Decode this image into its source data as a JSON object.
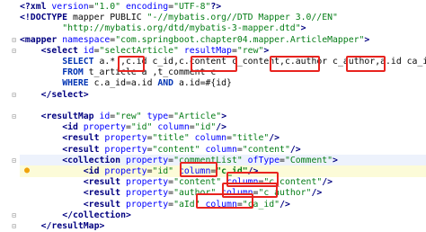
{
  "lines": [
    {
      "id": "l1",
      "segs": [
        [
          "tag",
          "<?"
        ],
        [
          "tag",
          "xml "
        ],
        [
          "attr",
          "version"
        ],
        [
          "plain",
          "="
        ],
        [
          "str",
          "\"1.0\""
        ],
        [
          "plain",
          " "
        ],
        [
          "attr",
          "encoding"
        ],
        [
          "plain",
          "="
        ],
        [
          "str",
          "\"UTF-8\""
        ],
        [
          "tag",
          "?>"
        ]
      ]
    },
    {
      "id": "l2",
      "segs": [
        [
          "tag",
          "<!DOCTYPE "
        ],
        [
          "plain",
          "mapper PUBLIC "
        ],
        [
          "str",
          "\"-//mybatis.org//DTD Mapper 3.0//EN\""
        ]
      ]
    },
    {
      "id": "l3",
      "segs": [
        [
          "plain",
          "        "
        ],
        [
          "str",
          "\"http://mybatis.org/dtd/mybatis-3-mapper.dtd\""
        ],
        [
          "tag",
          ">"
        ]
      ]
    },
    {
      "id": "l4",
      "segs": [
        [
          "tag",
          "<mapper "
        ],
        [
          "attr",
          "namespace"
        ],
        [
          "plain",
          "="
        ],
        [
          "str",
          "\"com.springboot.chapter04.mapper.ArticleMapper\""
        ],
        [
          "tag",
          ">"
        ]
      ]
    },
    {
      "id": "l5",
      "segs": [
        [
          "plain",
          "    "
        ],
        [
          "tag",
          "<select "
        ],
        [
          "attr",
          "id"
        ],
        [
          "plain",
          "="
        ],
        [
          "str",
          "\"selectArticle\""
        ],
        [
          "plain",
          " "
        ],
        [
          "attr",
          "resultMap"
        ],
        [
          "plain",
          "="
        ],
        [
          "str",
          "\"rew\""
        ],
        [
          "tag",
          ">"
        ]
      ]
    },
    {
      "id": "l6",
      "segs": [
        [
          "plain",
          "        "
        ],
        [
          "sqlkw",
          "SELECT"
        ],
        [
          "plain",
          " a.* ,c.id "
        ],
        [
          "plain",
          "c_id"
        ],
        [
          "plain",
          ",c.content "
        ],
        [
          "plain",
          "c_content"
        ],
        [
          "plain",
          ","
        ],
        [
          "plain",
          "c.author "
        ],
        [
          "plain",
          "c_author"
        ],
        [
          "plain",
          ",a.id "
        ],
        [
          "plain",
          "ca_id"
        ]
      ]
    },
    {
      "id": "l7",
      "segs": [
        [
          "plain",
          "        "
        ],
        [
          "sqlkw",
          "FROM"
        ],
        [
          "plain",
          " t_article a ,t_comment c"
        ]
      ]
    },
    {
      "id": "l8",
      "segs": [
        [
          "plain",
          "        "
        ],
        [
          "sqlkw",
          "WHERE"
        ],
        [
          "plain",
          " c.a_id=a.id "
        ],
        [
          "sqlkw",
          "AND"
        ],
        [
          "plain",
          " a.id="
        ],
        [
          "plain",
          "#{id}"
        ]
      ]
    },
    {
      "id": "l9",
      "segs": [
        [
          "plain",
          "    "
        ],
        [
          "tag",
          "</select>"
        ]
      ]
    },
    {
      "id": "l10",
      "segs": [
        [
          "plain",
          ""
        ]
      ]
    },
    {
      "id": "l11",
      "segs": [
        [
          "plain",
          "    "
        ],
        [
          "tag",
          "<resultMap "
        ],
        [
          "attr",
          "id"
        ],
        [
          "plain",
          "="
        ],
        [
          "str",
          "\"rew\""
        ],
        [
          "plain",
          " "
        ],
        [
          "attr",
          "type"
        ],
        [
          "plain",
          "="
        ],
        [
          "str",
          "\"Article\""
        ],
        [
          "tag",
          ">"
        ]
      ]
    },
    {
      "id": "l12",
      "segs": [
        [
          "plain",
          "        "
        ],
        [
          "tag",
          "<id "
        ],
        [
          "attr",
          "property"
        ],
        [
          "plain",
          "="
        ],
        [
          "str",
          "\"id\""
        ],
        [
          "plain",
          " "
        ],
        [
          "attr",
          "column"
        ],
        [
          "plain",
          "="
        ],
        [
          "str",
          "\"id\""
        ],
        [
          "tag",
          "/>"
        ]
      ]
    },
    {
      "id": "l13",
      "segs": [
        [
          "plain",
          "        "
        ],
        [
          "tag",
          "<result "
        ],
        [
          "attr",
          "property"
        ],
        [
          "plain",
          "="
        ],
        [
          "str",
          "\"title\""
        ],
        [
          "plain",
          " "
        ],
        [
          "attr",
          "column"
        ],
        [
          "plain",
          "="
        ],
        [
          "str",
          "\"title\""
        ],
        [
          "tag",
          "/>"
        ]
      ]
    },
    {
      "id": "l14",
      "segs": [
        [
          "plain",
          "        "
        ],
        [
          "tag",
          "<result "
        ],
        [
          "attr",
          "property"
        ],
        [
          "plain",
          "="
        ],
        [
          "str",
          "\"content\""
        ],
        [
          "plain",
          " "
        ],
        [
          "attr",
          "column"
        ],
        [
          "plain",
          "="
        ],
        [
          "str",
          "\"content\""
        ],
        [
          "tag",
          "/>"
        ]
      ]
    },
    {
      "id": "l15",
      "segs": [
        [
          "plain",
          "        "
        ],
        [
          "tag",
          "<collection "
        ],
        [
          "attr",
          "property"
        ],
        [
          "plain",
          "="
        ],
        [
          "str",
          "\"commentList\""
        ],
        [
          "plain",
          " "
        ],
        [
          "attr",
          "ofType"
        ],
        [
          "plain",
          "="
        ],
        [
          "str",
          "\"Comment\""
        ],
        [
          "tag",
          ">"
        ]
      ]
    },
    {
      "id": "l16",
      "segs": [
        [
          "plain",
          "            "
        ],
        [
          "tag",
          "<id "
        ],
        [
          "attr",
          "property"
        ],
        [
          "plain",
          "="
        ],
        [
          "str",
          "\"id\""
        ],
        [
          "plain",
          " "
        ],
        [
          "attr",
          "column"
        ],
        [
          "plain",
          "="
        ],
        [
          "strg",
          "\"c_id\""
        ],
        [
          "tag",
          "/>"
        ]
      ]
    },
    {
      "id": "l17",
      "segs": [
        [
          "plain",
          "            "
        ],
        [
          "tag",
          "<result "
        ],
        [
          "attr",
          "property"
        ],
        [
          "plain",
          "="
        ],
        [
          "str",
          "\"content\""
        ],
        [
          "plain",
          " "
        ],
        [
          "attr",
          "column"
        ],
        [
          "plain",
          "="
        ],
        [
          "str",
          "\"c_content\""
        ],
        [
          "tag",
          "/>"
        ]
      ]
    },
    {
      "id": "l18",
      "segs": [
        [
          "plain",
          "            "
        ],
        [
          "tag",
          "<result "
        ],
        [
          "attr",
          "property"
        ],
        [
          "plain",
          "="
        ],
        [
          "str",
          "\"author\""
        ],
        [
          "plain",
          " "
        ],
        [
          "attr",
          "column"
        ],
        [
          "plain",
          "="
        ],
        [
          "str",
          "\"c_author\""
        ],
        [
          "tag",
          "/>"
        ]
      ]
    },
    {
      "id": "l19",
      "segs": [
        [
          "plain",
          "            "
        ],
        [
          "tag",
          "<result "
        ],
        [
          "attr",
          "property"
        ],
        [
          "plain",
          "="
        ],
        [
          "str",
          "\"aId\""
        ],
        [
          "plain",
          " "
        ],
        [
          "attr",
          "column"
        ],
        [
          "plain",
          "="
        ],
        [
          "str",
          "\"ca_id\""
        ],
        [
          "tag",
          "/>"
        ]
      ]
    },
    {
      "id": "l20",
      "segs": [
        [
          "plain",
          "        "
        ],
        [
          "tag",
          "</collection>"
        ]
      ]
    },
    {
      "id": "l21",
      "segs": [
        [
          "plain",
          "    "
        ],
        [
          "tag",
          "</resultMap>"
        ]
      ]
    }
  ],
  "icons": {
    "bulb": "lightbulb-icon",
    "fold": "fold-marker-icon"
  },
  "colors": {
    "tag": "#000080",
    "attr": "#0000ff",
    "string": "#067d17",
    "keyword": "#0033b3",
    "highlight": "#e8231e"
  }
}
